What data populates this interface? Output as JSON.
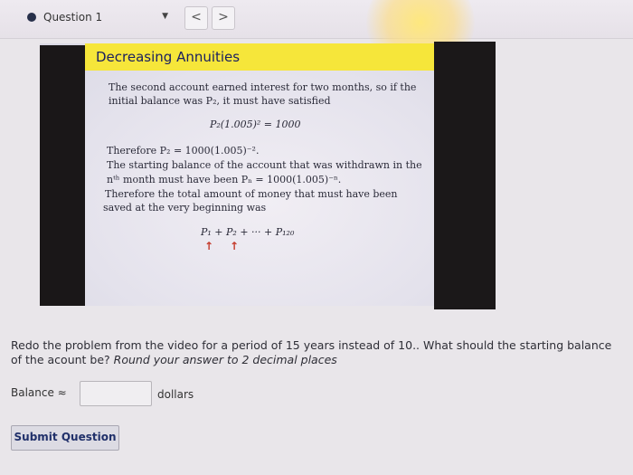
{
  "header": {
    "question_label": "Question 1",
    "prev_icon": "chevron-left-icon",
    "next_icon": "chevron-right-icon",
    "prev_glyph": "<",
    "next_glyph": ">",
    "dropdown_glyph": "▼"
  },
  "video_slide": {
    "title": "Decreasing Annuities",
    "line1": "The second account earned interest for two months, so if the",
    "line2": "initial balance was P₂, it must have satisfied",
    "eq1": "P₂(1.005)² = 1000",
    "line3": "Therefore P₂ = 1000(1.005)⁻².",
    "line4": "The starting balance of the account that was withdrawn in the",
    "line5": "nᵗʰ month must have been Pₙ = 1000(1.005)⁻ⁿ.",
    "line6": "Therefore the total amount of money that must have been",
    "line7": "saved at the very beginning was",
    "eq2": "P₁ + P₂ + ··· + P₁₂₀"
  },
  "question": {
    "text": "Redo the problem from the video for a period of 15 years instead of 10.. What should the starting balance of the acount be?",
    "instruction": "Round your answer to 2 decimal places"
  },
  "answer": {
    "label": "Balance ≈",
    "value": "",
    "units": "dollars"
  },
  "submit_label": "Submit Question"
}
